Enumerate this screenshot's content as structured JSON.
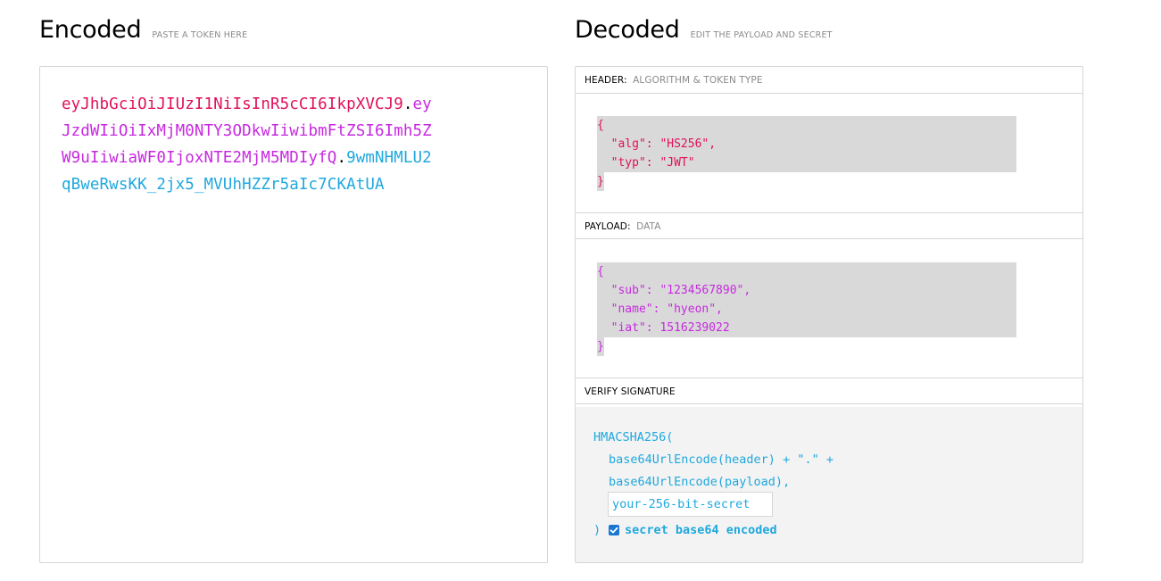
{
  "encoded": {
    "title": "Encoded",
    "subtitle": "PASTE A TOKEN HERE",
    "token_lines": [
      [
        {
          "part": "header",
          "text": "eyJhbGciOiJIUzI1NiIsInR5cCI6IkpXVCJ9"
        },
        {
          "part": "dot",
          "text": "."
        },
        {
          "part": "payload",
          "text": "ey"
        }
      ],
      [
        {
          "part": "payload",
          "text": "JzdWIiOiIxMjM0NTY3ODkwIiwibmFtZSI6Imh5Z"
        }
      ],
      [
        {
          "part": "payload",
          "text": "W9uIiwiaWF0IjoxNTE2MjM5MDIyfQ"
        },
        {
          "part": "dot",
          "text": "."
        },
        {
          "part": "sig",
          "text": "9wmNHMLU2"
        }
      ],
      [
        {
          "part": "sig",
          "text": "qBweRwsKK_2jx5_MVUhHZZr5aIc7CKAtUA"
        }
      ]
    ]
  },
  "decoded": {
    "title": "Decoded",
    "subtitle": "EDIT THE PAYLOAD AND SECRET",
    "header_section": {
      "label": "HEADER:",
      "sublabel": "ALGORITHM & TOKEN TYPE",
      "lines": [
        "{",
        "  \"alg\": \"HS256\",",
        "  \"typ\": \"JWT\"",
        "}"
      ]
    },
    "payload_section": {
      "label": "PAYLOAD:",
      "sublabel": "DATA",
      "lines": [
        "{",
        "  \"sub\": \"1234567890\",",
        "  \"name\": \"hyeon\",",
        "  \"iat\": 1516239022",
        "}"
      ]
    },
    "verify_section": {
      "label": "VERIFY SIGNATURE",
      "fn_open": "HMACSHA256(",
      "line_header": "base64UrlEncode(header) + \".\" +",
      "line_payload": "base64UrlEncode(payload),",
      "secret_placeholder": "your-256-bit-secret",
      "fn_close": ")",
      "checkbox_label": "secret base64 encoded",
      "checkbox_checked": true
    }
  },
  "colors": {
    "header": "#e0105a",
    "payload": "#c729e0",
    "signature": "#1fa8de",
    "checkbox": "#1976d2"
  }
}
